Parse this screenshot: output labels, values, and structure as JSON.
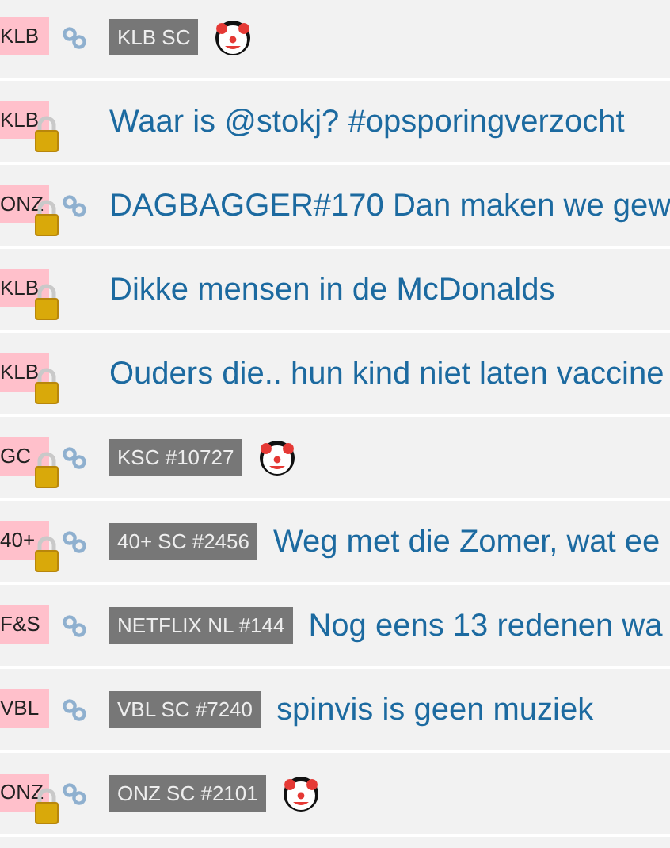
{
  "rows": [
    {
      "tag": "KLB",
      "locked": false,
      "linked": true,
      "badge": "KLB SC",
      "clown": true
    },
    {
      "tag": "KLB",
      "locked": true,
      "linked": false,
      "title": "Waar is @stokj? #opsporingverzocht",
      "clown": false
    },
    {
      "tag": "ONZ",
      "locked": true,
      "linked": true,
      "title": "DAGBAGGER#170 Dan maken we gew",
      "clown": false
    },
    {
      "tag": "KLB",
      "locked": true,
      "linked": false,
      "title": "Dikke mensen in de McDonalds",
      "clown": false
    },
    {
      "tag": "KLB",
      "locked": true,
      "linked": false,
      "title": "Ouders die.. hun kind niet laten vaccine",
      "clown": false
    },
    {
      "tag": "GC",
      "locked": true,
      "linked": true,
      "badge": "KSC #10727",
      "clown": true
    },
    {
      "tag": "40+",
      "locked": true,
      "linked": true,
      "badge": "40+ SC #2456",
      "title": "Weg met die Zomer, wat ee",
      "clown": false
    },
    {
      "tag": "F&S",
      "locked": false,
      "linked": true,
      "badge": "NETFLIX NL #144",
      "title": "Nog eens 13 redenen wa",
      "clown": false
    },
    {
      "tag": "VBL",
      "locked": false,
      "linked": true,
      "badge": "VBL SC #7240",
      "title": "spinvis is geen muziek",
      "clown": false
    },
    {
      "tag": "ONZ",
      "locked": true,
      "linked": true,
      "badge": "ONZ SC #2101",
      "clown": true
    }
  ]
}
